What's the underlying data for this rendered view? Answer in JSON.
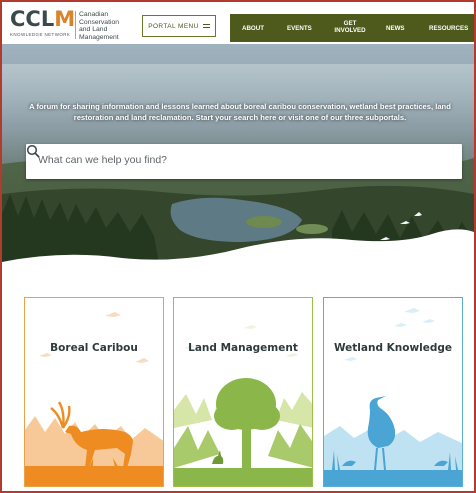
{
  "header": {
    "logo": {
      "letters_a": "CCL",
      "letters_b": "M",
      "subtitle": "KNOWLEDGE NETWORK",
      "name_lines": [
        "Canadian",
        "Conservation",
        "and Land",
        "Management"
      ]
    },
    "portal_menu_label": "PORTAL MENU",
    "nav": {
      "about": "ABOUT",
      "events": "EVENTS",
      "get_involved": "GET INVOLVED",
      "news": "NEWS",
      "resources": "RESOURCES"
    }
  },
  "hero": {
    "tagline": "A forum for sharing information and lessons learned about boreal caribou conservation, wetland best practices, land restoration and land reclamation. Start your search here or visit one of our three subportals.",
    "search": {
      "placeholder": "What can we help you find?",
      "icon": "search-icon"
    }
  },
  "subportals": [
    {
      "title": "Boreal Caribou",
      "accent": "#e9a24c",
      "illustration": "caribou-icon"
    },
    {
      "title": "Land Management",
      "accent": "#9bbf4a",
      "illustration": "tree-icon"
    },
    {
      "title": "Wetland Knowledge",
      "accent": "#5aaed8",
      "illustration": "heron-icon"
    }
  ],
  "colors": {
    "nav_bg": "#4d5a1c",
    "frame": "#b23a2e",
    "logo_dark": "#3a4a4c",
    "logo_orange": "#d9832a"
  }
}
